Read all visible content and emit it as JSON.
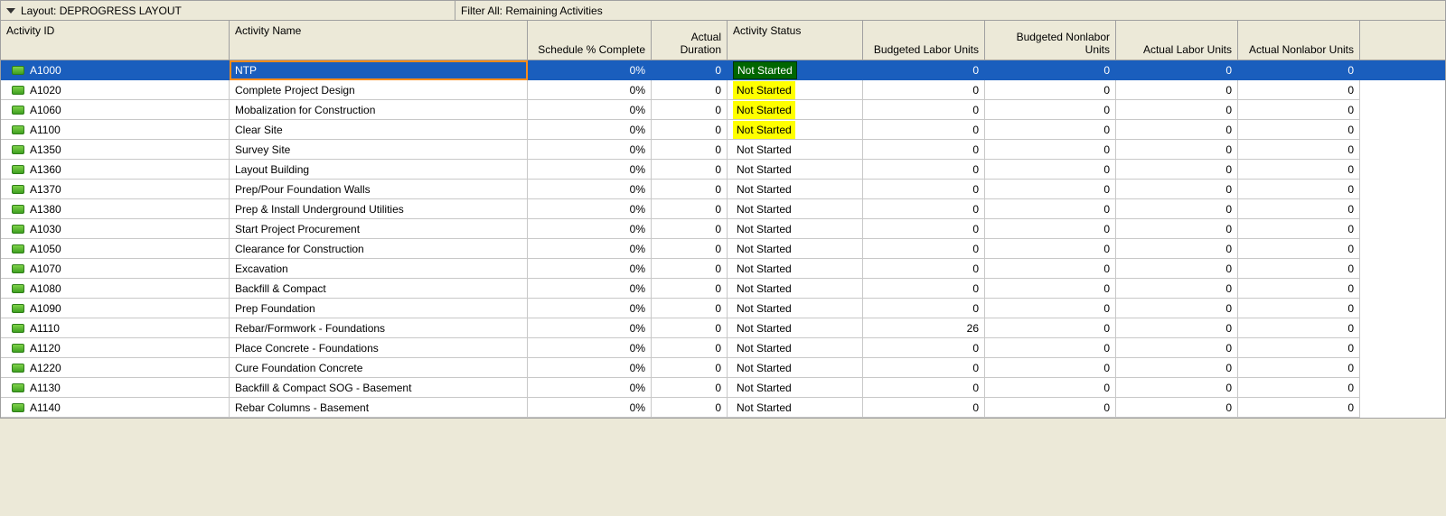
{
  "topbar": {
    "layout_label": "Layout: DEPROGRESS LAYOUT",
    "filter_label": "Filter All: Remaining Activities"
  },
  "headers": {
    "id": "Activity ID",
    "name": "Activity Name",
    "sched": "Schedule % Complete",
    "adur": "Actual Duration",
    "stat": "Activity Status",
    "blu": "Budgeted Labor Units",
    "bnu": "Budgeted Nonlabor Units",
    "alu": "Actual Labor Units",
    "anu": "Actual Nonlabor Units"
  },
  "rows": [
    {
      "id": "A1000",
      "name": "NTP",
      "sched": "0%",
      "adur": "0",
      "status": "Not Started",
      "blu": "0",
      "bnu": "0",
      "alu": "0",
      "anu": "0",
      "selected": true,
      "hl": "green"
    },
    {
      "id": "A1020",
      "name": "Complete Project Design",
      "sched": "0%",
      "adur": "0",
      "status": "Not Started",
      "blu": "0",
      "bnu": "0",
      "alu": "0",
      "anu": "0",
      "hl": "yellow"
    },
    {
      "id": "A1060",
      "name": "Mobalization for Construction",
      "sched": "0%",
      "adur": "0",
      "status": "Not Started",
      "blu": "0",
      "bnu": "0",
      "alu": "0",
      "anu": "0",
      "hl": "yellow"
    },
    {
      "id": "A1100",
      "name": "Clear Site",
      "sched": "0%",
      "adur": "0",
      "status": "Not Started",
      "blu": "0",
      "bnu": "0",
      "alu": "0",
      "anu": "0",
      "hl": "yellow"
    },
    {
      "id": "A1350",
      "name": "Survey Site",
      "sched": "0%",
      "adur": "0",
      "status": "Not Started",
      "blu": "0",
      "bnu": "0",
      "alu": "0",
      "anu": "0"
    },
    {
      "id": "A1360",
      "name": "Layout Building",
      "sched": "0%",
      "adur": "0",
      "status": "Not Started",
      "blu": "0",
      "bnu": "0",
      "alu": "0",
      "anu": "0"
    },
    {
      "id": "A1370",
      "name": "Prep/Pour Foundation Walls",
      "sched": "0%",
      "adur": "0",
      "status": "Not Started",
      "blu": "0",
      "bnu": "0",
      "alu": "0",
      "anu": "0"
    },
    {
      "id": "A1380",
      "name": "Prep & Install Underground Utilities",
      "sched": "0%",
      "adur": "0",
      "status": "Not Started",
      "blu": "0",
      "bnu": "0",
      "alu": "0",
      "anu": "0"
    },
    {
      "id": "A1030",
      "name": "Start Project Procurement",
      "sched": "0%",
      "adur": "0",
      "status": "Not Started",
      "blu": "0",
      "bnu": "0",
      "alu": "0",
      "anu": "0"
    },
    {
      "id": "A1050",
      "name": "Clearance for Construction",
      "sched": "0%",
      "adur": "0",
      "status": "Not Started",
      "blu": "0",
      "bnu": "0",
      "alu": "0",
      "anu": "0"
    },
    {
      "id": "A1070",
      "name": "Excavation",
      "sched": "0%",
      "adur": "0",
      "status": "Not Started",
      "blu": "0",
      "bnu": "0",
      "alu": "0",
      "anu": "0"
    },
    {
      "id": "A1080",
      "name": "Backfill & Compact",
      "sched": "0%",
      "adur": "0",
      "status": "Not Started",
      "blu": "0",
      "bnu": "0",
      "alu": "0",
      "anu": "0"
    },
    {
      "id": "A1090",
      "name": "Prep Foundation",
      "sched": "0%",
      "adur": "0",
      "status": "Not Started",
      "blu": "0",
      "bnu": "0",
      "alu": "0",
      "anu": "0"
    },
    {
      "id": "A1110",
      "name": "Rebar/Formwork - Foundations",
      "sched": "0%",
      "adur": "0",
      "status": "Not Started",
      "blu": "26",
      "bnu": "0",
      "alu": "0",
      "anu": "0"
    },
    {
      "id": "A1120",
      "name": "Place Concrete - Foundations",
      "sched": "0%",
      "adur": "0",
      "status": "Not Started",
      "blu": "0",
      "bnu": "0",
      "alu": "0",
      "anu": "0"
    },
    {
      "id": "A1220",
      "name": "Cure Foundation Concrete",
      "sched": "0%",
      "adur": "0",
      "status": "Not Started",
      "blu": "0",
      "bnu": "0",
      "alu": "0",
      "anu": "0"
    },
    {
      "id": "A1130",
      "name": "Backfill & Compact SOG - Basement",
      "sched": "0%",
      "adur": "0",
      "status": "Not Started",
      "blu": "0",
      "bnu": "0",
      "alu": "0",
      "anu": "0"
    },
    {
      "id": "A1140",
      "name": "Rebar Columns - Basement",
      "sched": "0%",
      "adur": "0",
      "status": "Not Started",
      "blu": "0",
      "bnu": "0",
      "alu": "0",
      "anu": "0"
    }
  ]
}
